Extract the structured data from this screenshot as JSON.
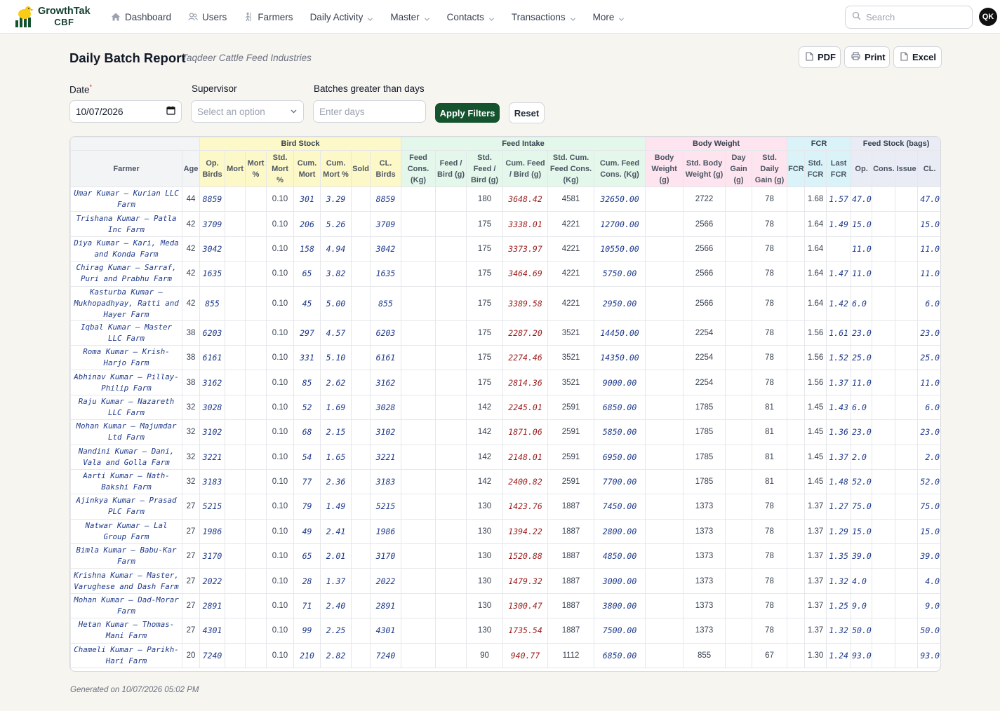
{
  "brand": {
    "name_line1": "GrowthTak",
    "name_line2": "CBF"
  },
  "nav": [
    {
      "label": "Dashboard",
      "icon": "home-icon",
      "dropdown": false
    },
    {
      "label": "Users",
      "icon": "users-icon",
      "dropdown": false
    },
    {
      "label": "Farmers",
      "icon": "farmer-icon",
      "dropdown": false
    },
    {
      "label": "Daily Activity",
      "icon": "",
      "dropdown": true
    },
    {
      "label": "Master",
      "icon": "",
      "dropdown": true
    },
    {
      "label": "Contacts",
      "icon": "",
      "dropdown": true
    },
    {
      "label": "Transactions",
      "icon": "",
      "dropdown": true
    },
    {
      "label": "More",
      "icon": "",
      "dropdown": true
    }
  ],
  "search": {
    "placeholder": "Search"
  },
  "user": {
    "initials": "QK"
  },
  "header": {
    "title": "Daily Batch Report",
    "subtitle": "Taqdeer Cattle Feed Industries",
    "pdf_label": "PDF",
    "print_label": "Print",
    "excel_label": "Excel"
  },
  "filters": {
    "date_label": "Date",
    "date_required": "*",
    "date_value": "10/07/2026",
    "supervisor_label": "Supervisor",
    "supervisor_placeholder": "Select an option",
    "days_label": "Batches greater than days",
    "days_placeholder": "Enter days",
    "apply_label": "Apply Filters",
    "reset_label": "Reset"
  },
  "table": {
    "groups": {
      "bird_stock": "Bird Stock",
      "feed_intake": "Feed Intake",
      "body_weight": "Body Weight",
      "fcr": "FCR",
      "feed_stock": "Feed Stock (bags)"
    },
    "columns": [
      "Farmer",
      "Age",
      "Op. Birds",
      "Mort",
      "Mort %",
      "Std. Mort %",
      "Cum. Mort",
      "Cum. Mort %",
      "Sold",
      "CL. Birds",
      "Feed Cons. (Kg)",
      "Feed / Bird (g)",
      "Std. Feed / Bird (g)",
      "Cum. Feed / Bird (g)",
      "Std. Cum. Feed Cons. (Kg)",
      "Cum. Feed Cons. (Kg)",
      "Body Weight (g)",
      "Std. Body Weight (g)",
      "Day Gain (g)",
      "Std. Daily Gain (g)",
      "FCR",
      "Std. FCR",
      "Last FCR",
      "Op.",
      "Cons.",
      "Issue",
      "CL."
    ],
    "rows": [
      [
        "Umar Kumar – Kurian LLC Farm",
        "44",
        "8859",
        "",
        "",
        "0.10",
        "301",
        "3.29",
        "",
        "8859",
        "",
        "",
        "180",
        "3648.42",
        "4581",
        "32650.00",
        "",
        "2722",
        "",
        "78",
        "",
        "1.68",
        "1.57",
        "47.0",
        "",
        "",
        "47.0"
      ],
      [
        "Trishana Kumar – Patla Inc Farm",
        "42",
        "3709",
        "",
        "",
        "0.10",
        "206",
        "5.26",
        "",
        "3709",
        "",
        "",
        "175",
        "3338.01",
        "4221",
        "12700.00",
        "",
        "2566",
        "",
        "78",
        "",
        "1.64",
        "1.49",
        "15.0",
        "",
        "",
        "15.0"
      ],
      [
        "Diya Kumar – Kari, Meda and Konda Farm",
        "42",
        "3042",
        "",
        "",
        "0.10",
        "158",
        "4.94",
        "",
        "3042",
        "",
        "",
        "175",
        "3373.97",
        "4221",
        "10550.00",
        "",
        "2566",
        "",
        "78",
        "",
        "1.64",
        "",
        "11.0",
        "",
        "",
        "11.0"
      ],
      [
        "Chirag Kumar – Sarraf, Puri and Prabhu Farm",
        "42",
        "1635",
        "",
        "",
        "0.10",
        "65",
        "3.82",
        "",
        "1635",
        "",
        "",
        "175",
        "3464.69",
        "4221",
        "5750.00",
        "",
        "2566",
        "",
        "78",
        "",
        "1.64",
        "1.47",
        "11.0",
        "",
        "",
        "11.0"
      ],
      [
        "Kasturba Kumar – Mukhopadhyay, Ratti and Hayer Farm",
        "42",
        "855",
        "",
        "",
        "0.10",
        "45",
        "5.00",
        "",
        "855",
        "",
        "",
        "175",
        "3389.58",
        "4221",
        "2950.00",
        "",
        "2566",
        "",
        "78",
        "",
        "1.64",
        "1.42",
        "6.0",
        "",
        "",
        "6.0"
      ],
      [
        "Iqbal Kumar – Master LLC Farm",
        "38",
        "6203",
        "",
        "",
        "0.10",
        "297",
        "4.57",
        "",
        "6203",
        "",
        "",
        "175",
        "2287.20",
        "3521",
        "14450.00",
        "",
        "2254",
        "",
        "78",
        "",
        "1.56",
        "1.61",
        "23.0",
        "",
        "",
        "23.0"
      ],
      [
        "Roma Kumar – Krish-Harjo Farm",
        "38",
        "6161",
        "",
        "",
        "0.10",
        "331",
        "5.10",
        "",
        "6161",
        "",
        "",
        "175",
        "2274.46",
        "3521",
        "14350.00",
        "",
        "2254",
        "",
        "78",
        "",
        "1.56",
        "1.52",
        "25.0",
        "",
        "",
        "25.0"
      ],
      [
        "Abhinav Kumar – Pillay-Philip Farm",
        "38",
        "3162",
        "",
        "",
        "0.10",
        "85",
        "2.62",
        "",
        "3162",
        "",
        "",
        "175",
        "2814.36",
        "3521",
        "9000.00",
        "",
        "2254",
        "",
        "78",
        "",
        "1.56",
        "1.37",
        "11.0",
        "",
        "",
        "11.0"
      ],
      [
        "Raju Kumar – Nazareth LLC Farm",
        "32",
        "3028",
        "",
        "",
        "0.10",
        "52",
        "1.69",
        "",
        "3028",
        "",
        "",
        "142",
        "2245.01",
        "2591",
        "6850.00",
        "",
        "1785",
        "",
        "81",
        "",
        "1.45",
        "1.43",
        "6.0",
        "",
        "",
        "6.0"
      ],
      [
        "Mohan Kumar – Majumdar Ltd Farm",
        "32",
        "3102",
        "",
        "",
        "0.10",
        "68",
        "2.15",
        "",
        "3102",
        "",
        "",
        "142",
        "1871.06",
        "2591",
        "5850.00",
        "",
        "1785",
        "",
        "81",
        "",
        "1.45",
        "1.36",
        "23.0",
        "",
        "",
        "23.0"
      ],
      [
        "Nandini Kumar – Dani, Vala and Golla Farm",
        "32",
        "3221",
        "",
        "",
        "0.10",
        "54",
        "1.65",
        "",
        "3221",
        "",
        "",
        "142",
        "2148.01",
        "2591",
        "6950.00",
        "",
        "1785",
        "",
        "81",
        "",
        "1.45",
        "1.37",
        "2.0",
        "",
        "",
        "2.0"
      ],
      [
        "Aarti Kumar – Nath-Bakshi Farm",
        "32",
        "3183",
        "",
        "",
        "0.10",
        "77",
        "2.36",
        "",
        "3183",
        "",
        "",
        "142",
        "2400.82",
        "2591",
        "7700.00",
        "",
        "1785",
        "",
        "81",
        "",
        "1.45",
        "1.48",
        "52.0",
        "",
        "",
        "52.0"
      ],
      [
        "Ajinkya Kumar – Prasad PLC Farm",
        "27",
        "5215",
        "",
        "",
        "0.10",
        "79",
        "1.49",
        "",
        "5215",
        "",
        "",
        "130",
        "1423.76",
        "1887",
        "7450.00",
        "",
        "1373",
        "",
        "78",
        "",
        "1.37",
        "1.27",
        "75.0",
        "",
        "",
        "75.0"
      ],
      [
        "Natwar Kumar – Lal Group Farm",
        "27",
        "1986",
        "",
        "",
        "0.10",
        "49",
        "2.41",
        "",
        "1986",
        "",
        "",
        "130",
        "1394.22",
        "1887",
        "2800.00",
        "",
        "1373",
        "",
        "78",
        "",
        "1.37",
        "1.29",
        "15.0",
        "",
        "",
        "15.0"
      ],
      [
        "Bimla Kumar – Babu-Kar Farm",
        "27",
        "3170",
        "",
        "",
        "0.10",
        "65",
        "2.01",
        "",
        "3170",
        "",
        "",
        "130",
        "1520.88",
        "1887",
        "4850.00",
        "",
        "1373",
        "",
        "78",
        "",
        "1.37",
        "1.35",
        "39.0",
        "",
        "",
        "39.0"
      ],
      [
        "Krishna Kumar – Master, Varughese and Dash Farm",
        "27",
        "2022",
        "",
        "",
        "0.10",
        "28",
        "1.37",
        "",
        "2022",
        "",
        "",
        "130",
        "1479.32",
        "1887",
        "3000.00",
        "",
        "1373",
        "",
        "78",
        "",
        "1.37",
        "1.32",
        "4.0",
        "",
        "",
        "4.0"
      ],
      [
        "Mohan Kumar – Dad-Morar Farm",
        "27",
        "2891",
        "",
        "",
        "0.10",
        "71",
        "2.40",
        "",
        "2891",
        "",
        "",
        "130",
        "1300.47",
        "1887",
        "3800.00",
        "",
        "1373",
        "",
        "78",
        "",
        "1.37",
        "1.25",
        "9.0",
        "",
        "",
        "9.0"
      ],
      [
        "Hetan Kumar – Thomas-Mani Farm",
        "27",
        "4301",
        "",
        "",
        "0.10",
        "99",
        "2.25",
        "",
        "4301",
        "",
        "",
        "130",
        "1735.54",
        "1887",
        "7500.00",
        "",
        "1373",
        "",
        "78",
        "",
        "1.37",
        "1.32",
        "50.0",
        "",
        "",
        "50.0"
      ],
      [
        "Chameli Kumar – Parikh-Hari Farm",
        "20",
        "7240",
        "",
        "",
        "0.10",
        "210",
        "2.82",
        "",
        "7240",
        "",
        "",
        "90",
        "940.77",
        "1112",
        "6850.00",
        "",
        "855",
        "",
        "67",
        "",
        "1.30",
        "1.24",
        "93.0",
        "",
        "",
        "93.0"
      ]
    ]
  },
  "footer": {
    "generated": "Generated on 10/07/2026 05:02 PM"
  },
  "colors": {
    "accent": "#14532d",
    "bird_stock": "#fdf8c8",
    "feed_intake": "#e3f7ea",
    "body_weight": "#fde4ee",
    "fcr": "#d9f3f8",
    "feed_stock": "#eaecf5"
  }
}
